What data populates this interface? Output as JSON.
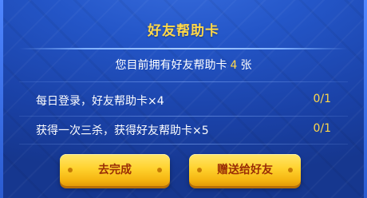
{
  "dialog": {
    "title": "好友帮助卡",
    "owned_prefix": "您目前拥有好友帮助卡",
    "owned_count": "4",
    "owned_suffix": "张"
  },
  "tasks": [
    {
      "label": "每日登录，好友帮助卡×4",
      "progress": "0/1"
    },
    {
      "label": "获得一次三杀，获得好友帮助卡×5",
      "progress": "0/1"
    }
  ],
  "buttons": {
    "go_complete": "去完成",
    "gift_friend": "赠送给好友"
  },
  "colors": {
    "background": "#2456c8",
    "title": "#ffd84a",
    "button": "#ffd22e",
    "button_text": "#9a2d06"
  }
}
